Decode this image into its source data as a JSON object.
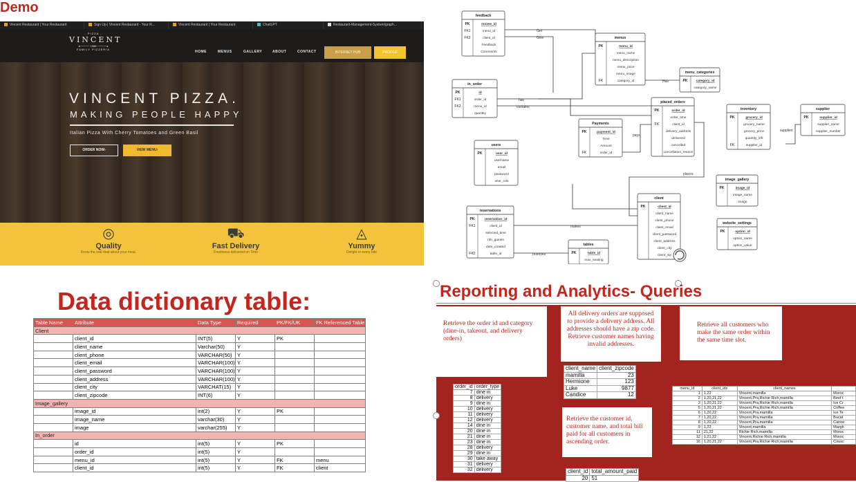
{
  "demo_label": "Demo",
  "browser_tabs": [
    "Vincent Restaurant | Your Restaurant",
    "Sign Up | Vincent Restaurant - Your R...",
    "Vincent Restaurant | Your Restaurant",
    "ChatGPT",
    "Restaurant-Management-System/graph..."
  ],
  "site": {
    "logo_top": "- PIZZA -",
    "logo_name": "VINCENT",
    "logo_since": "1988",
    "logo_sub": "FAMILY PIZZERIA",
    "nav": [
      "HOME",
      "MENUS",
      "GALLERY",
      "ABOUT",
      "CONTACT"
    ],
    "nav_btn1": "INTERNET HUB",
    "nav_btn2": "PROFILE",
    "hero_title": "VINCENT PIZZA.",
    "hero_sub": "MAKING PEOPLE HAPPY",
    "hero_desc": "Italian Pizza With Cherry Tomatoes and Green Basil",
    "order_btn": "ORDER NOW›",
    "menu_btn": "VIEW MENU›",
    "features": [
      {
        "icon": "pizza-icon",
        "title": "Quality",
        "desc": "Know the real deal about your meal."
      },
      {
        "icon": "delivery-truck-icon",
        "title": "Fast Delivery",
        "desc": "Freshness delivered on Time"
      },
      {
        "icon": "pizza-slice-icon",
        "title": "Yummy",
        "desc": "Delight in every bite"
      }
    ]
  },
  "erd": {
    "entities": {
      "feedback": {
        "title": "feedback",
        "rows": [
          [
            "PK",
            "review_id"
          ],
          [
            "FK1",
            "menu_id"
          ],
          [
            "FK2",
            "client_id"
          ],
          [
            "",
            "Feedback"
          ],
          [
            "",
            "Comments"
          ]
        ]
      },
      "menus": {
        "title": "menus",
        "rows": [
          [
            "PK",
            "menu_id"
          ],
          [
            "",
            "menu_name"
          ],
          [
            "",
            "menu_description"
          ],
          [
            "",
            "menu_price"
          ],
          [
            "",
            "menu_image"
          ],
          [
            "FK",
            "category_id"
          ]
        ]
      },
      "menu_categories": {
        "title": "menu_categories",
        "rows": [
          [
            "PK",
            "category_id"
          ],
          [
            "",
            "category_name"
          ]
        ]
      },
      "in_order": {
        "title": "in_order",
        "rows": [
          [
            "PK",
            "id"
          ],
          [
            "FK1",
            "order_id"
          ],
          [
            "FK2",
            "menu_id"
          ],
          [
            "",
            "quantity"
          ]
        ]
      },
      "placed_orders": {
        "title": "placed_orders",
        "rows": [
          [
            "PK",
            "order_id"
          ],
          [
            "",
            "order_time"
          ],
          [
            "FK",
            "client_id"
          ],
          [
            "",
            "delivery_address"
          ],
          [
            "",
            "delivered"
          ],
          [
            "",
            "cancelled"
          ],
          [
            "",
            "cancellation_reason"
          ]
        ]
      },
      "payments": {
        "title": "Payments",
        "rows": [
          [
            "PK",
            "payment_id"
          ],
          [
            "",
            "Time"
          ],
          [
            "",
            "Amount"
          ],
          [
            "FK",
            "order_id"
          ]
        ]
      },
      "inventory": {
        "title": "inventory",
        "rows": [
          [
            "PK",
            "grocery_id"
          ],
          [
            "",
            "grocery_name"
          ],
          [
            "",
            "grocery_price"
          ],
          [
            "",
            "quantity_left"
          ],
          [
            "FK",
            "supplier_id"
          ]
        ]
      },
      "supplier": {
        "title": "supplier",
        "rows": [
          [
            "PK",
            "supplier_id"
          ],
          [
            "",
            "supplier_name"
          ],
          [
            "",
            "supplier_number"
          ]
        ]
      },
      "users": {
        "title": "users",
        "rows": [
          [
            "PK",
            "user_id"
          ],
          [
            "",
            "username"
          ],
          [
            "",
            "email"
          ],
          [
            "",
            "password"
          ],
          [
            "",
            "user_role"
          ]
        ]
      },
      "image_gallery": {
        "title": "image_gallery",
        "rows": [
          [
            "PK",
            "image_id"
          ],
          [
            "",
            "image_name"
          ],
          [
            "",
            "image"
          ]
        ]
      },
      "client": {
        "title": "client",
        "rows": [
          [
            "PK",
            "client_id"
          ],
          [
            "",
            "client_name"
          ],
          [
            "",
            "client_phone"
          ],
          [
            "",
            "client_email"
          ],
          [
            "",
            "client_password"
          ],
          [
            "",
            "client_address"
          ],
          [
            "",
            "client_city"
          ],
          [
            "",
            "client_zip"
          ]
        ]
      },
      "website_settings": {
        "title": "website_settings",
        "rows": [
          [
            "PK",
            "option_id"
          ],
          [
            "",
            "option_name"
          ],
          [
            "",
            "option_value"
          ]
        ]
      },
      "reservations": {
        "title": "reservations",
        "rows": [
          [
            "PK",
            "reservation_id"
          ],
          [
            "FK1",
            "client_id"
          ],
          [
            "",
            "selected_time"
          ],
          [
            "",
            "nbr_guests"
          ],
          [
            "",
            "date_created"
          ],
          [
            "FK2",
            "table_id"
          ]
        ]
      },
      "tables": {
        "title": "tables",
        "rows": [
          [
            "PK",
            "table_id"
          ],
          [
            "",
            "max_seating"
          ]
        ]
      }
    },
    "rel_labels": {
      "gets": "Get",
      "gives": "Give",
      "has1": "Has",
      "has2": "has",
      "contains": "contains",
      "pays": "pays",
      "supplies": "supplies",
      "places": "places",
      "makes": "makes",
      "reserves": "reserves"
    }
  },
  "data_dictionary": {
    "title": "Data dictionary table:",
    "headers": [
      "Table Name",
      "Attribute",
      "Data Type",
      "Required",
      "PK/FK/UK",
      "FK Referenced Table"
    ],
    "rows": [
      {
        "section": "Client"
      },
      {
        "cells": [
          "",
          "client_id",
          "INT(5)",
          "Y",
          "PK",
          ""
        ]
      },
      {
        "cells": [
          "",
          "client_name",
          "Varchar(50)",
          "Y",
          "",
          ""
        ]
      },
      {
        "cells": [
          "",
          "client_phone",
          "VARCHAR(50)",
          "Y",
          "",
          ""
        ]
      },
      {
        "cells": [
          "",
          "client_email",
          "VARCHAR(100)",
          "Y",
          "",
          ""
        ]
      },
      {
        "cells": [
          "",
          "client_password",
          "VARCHAR(100)",
          "Y",
          "",
          ""
        ]
      },
      {
        "cells": [
          "",
          "client_address",
          "VARCHAR(100)",
          "Y",
          "",
          ""
        ]
      },
      {
        "cells": [
          "",
          "client_city",
          "VARCHAT(15)",
          "Y",
          "",
          ""
        ]
      },
      {
        "cells": [
          "",
          "client_zipcode",
          "INT(6)",
          "Y",
          "",
          ""
        ]
      },
      {
        "section": "Image_gallery"
      },
      {
        "cells": [
          "",
          "image_id",
          "int(2)",
          "Y",
          "PK",
          ""
        ]
      },
      {
        "cells": [
          "",
          "image_name",
          "varchar(30)",
          "Y",
          "",
          ""
        ]
      },
      {
        "cells": [
          "",
          "image",
          "varchar(255)",
          "Y",
          "",
          ""
        ]
      },
      {
        "section": "In_order"
      },
      {
        "cells": [
          "",
          "id",
          "int(5)",
          "Y",
          "PK",
          ""
        ]
      },
      {
        "cells": [
          "",
          "order_id",
          "int(5)",
          "Y",
          "",
          ""
        ]
      },
      {
        "cells": [
          "",
          "menu_id",
          "int(5)",
          "Y",
          "FK",
          "menu"
        ]
      },
      {
        "cells": [
          "",
          "client_id",
          "int(5)",
          "Y",
          "FK",
          "client"
        ]
      }
    ]
  },
  "reporting": {
    "title": "Reporting and Analytics- Queries",
    "q1": "Retrieve the order id and category (dine-in, takeout, and delivery orders)",
    "q2": "All delivery orders are supposed to provide a delivery address. All addresses should have a zip code. Retrieve customer names having invalid addresses.",
    "q3": "Retrieve all customers who make the same order within the same time slot.",
    "q4": "Retrieve the customer id, customer name, and total bill paid for all customers in ascending order.",
    "orders_table": {
      "headers": [
        "order_id",
        "order_type"
      ],
      "rows": [
        [
          "7",
          "dine in"
        ],
        [
          "8",
          "delivery"
        ],
        [
          "9",
          "dine in"
        ],
        [
          "10",
          "delivery"
        ],
        [
          "11",
          "delivery"
        ],
        [
          "12",
          "delivery"
        ],
        [
          "14",
          "dine in"
        ],
        [
          "20",
          "dine in"
        ],
        [
          "21",
          "dine in"
        ],
        [
          "23",
          "dine in"
        ],
        [
          "28",
          "delivery"
        ],
        [
          "29",
          "dine in"
        ],
        [
          "30",
          "take away"
        ],
        [
          "31",
          "delivery"
        ],
        [
          "32",
          "delivery"
        ]
      ]
    },
    "zip_table": {
      "headers": [
        "client_name",
        "client_zipcode"
      ],
      "rows": [
        [
          "mamilla",
          "23"
        ],
        [
          "Hermione",
          "123"
        ],
        [
          "Luke",
          "9877"
        ],
        [
          "Candice",
          "12"
        ]
      ]
    },
    "same_order_table": {
      "headers": [
        "menu_id",
        "client_ids",
        "client_names",
        ""
      ],
      "rows": [
        [
          "1",
          "1,22",
          "Vincent,mamilla",
          "Moroc"
        ],
        [
          "2",
          "1,20,21,22",
          "Vincent,Pra,Richie Rich,mamilla",
          "Beef t"
        ],
        [
          "3",
          "1,20,21,22",
          "Vincent,Pra,Richie Rich,mamilla",
          "Ice Cr"
        ],
        [
          "5",
          "1,20,21,22",
          "Vincent,Pra,Richie Rich,mamilla",
          "Coffee"
        ],
        [
          "6",
          "1,20,22",
          "Vincent,Pra,mamilla",
          "Ice Te"
        ],
        [
          "7",
          "1,20,22",
          "Vincent,Pra,mamilla",
          "Bucat"
        ],
        [
          "8",
          "1,20,22",
          "Vincent,Pra,mamilla",
          "Canne"
        ],
        [
          "9",
          "1,22",
          "Vincent,mamilla",
          "Margh"
        ],
        [
          "11",
          "21,22",
          "Richie Rich,mamilla",
          "Moroc"
        ],
        [
          "12",
          "1,21,22",
          "Vincent,Richie Rich,mamilla",
          "Moroc"
        ],
        [
          "16",
          "1,20,21,22",
          "Vincent,Pra,Richie Rich,mamilla",
          "Cousc"
        ]
      ]
    },
    "bill_table": {
      "headers": [
        "client_id",
        "total_amount_paid"
      ],
      "rows": [
        [
          "20",
          "51"
        ]
      ]
    }
  },
  "colors": {
    "accent_red": "#c0281f",
    "panel_red": "#a3231f",
    "feature_yellow": "#f3c33c"
  }
}
